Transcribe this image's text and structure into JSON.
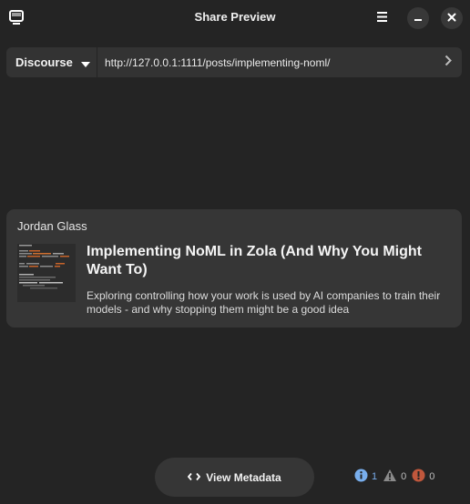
{
  "window": {
    "title": "Share Preview",
    "icons": {
      "app": "monitor-icon",
      "menu": "hamburger-menu-icon",
      "minimize": "minimize-icon",
      "close": "close-icon"
    }
  },
  "url_bar": {
    "platform": "Discourse",
    "url": "http://127.0.0.1:1111/posts/implementing-noml/",
    "go_icon": "chevron-right-icon"
  },
  "preview_card": {
    "site_name": "Jordan Glass",
    "title": "Implementing NoML in Zola (And Why You Might Want To)",
    "description": "Exploring controlling how your work is used by AI companies to train their models - and why stopping them might be a good idea",
    "thumbnail": "code-screenshot-thumbnail"
  },
  "footer": {
    "view_metadata_label": "View Metadata",
    "view_metadata_icon": "code-brackets-icon",
    "status": {
      "info_count": "1",
      "warning_count": "0",
      "error_count": "0"
    }
  },
  "colors": {
    "background": "#242424",
    "card": "#363636",
    "info": "#78aeed",
    "warning": "#8a8a8a",
    "error": "#c0573c"
  }
}
